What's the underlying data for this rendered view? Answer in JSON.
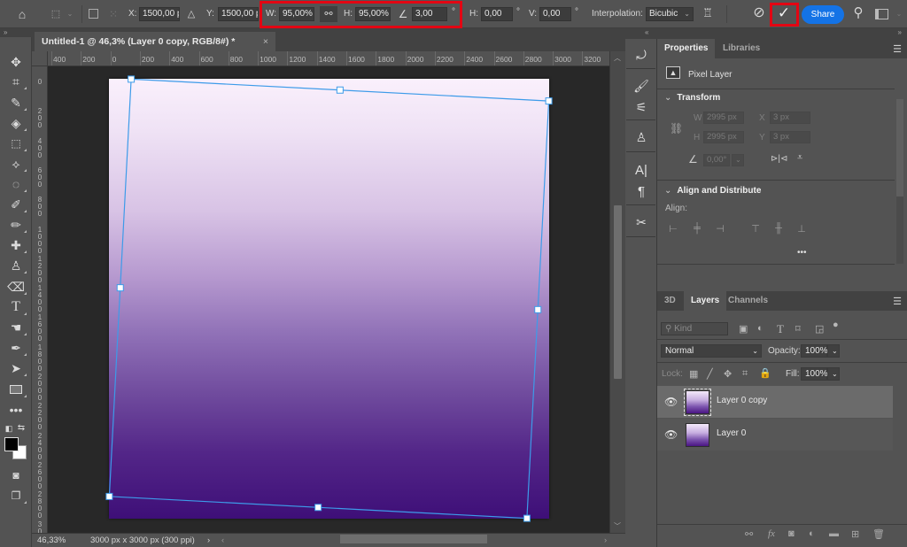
{
  "options_bar": {
    "x_label": "X:",
    "x_value": "1500,00 p",
    "y_label": "Y:",
    "y_value": "1500,00 p",
    "w_label": "W:",
    "w_value": "95,00%",
    "h_label": "H:",
    "h_value": "95,00%",
    "angle_value": "3,00",
    "degree": "°",
    "skew_h_label": "H:",
    "skew_h_value": "0,00",
    "skew_v_label": "V:",
    "skew_v_value": "0,00",
    "interpolation_label": "Interpolation:",
    "interpolation_value": "Bicubic",
    "share_label": "Share",
    "highlight_color": "#e30613"
  },
  "document": {
    "tab_title": "Untitled-1 @ 46,3% (Layer 0 copy, RGB/8#) *",
    "close_glyph": "×",
    "zoom": "46,33%",
    "doc_info": "3000 px x 3000 px (300 ppi)",
    "gradient_top": "#faf0fc",
    "gradient_bottom": "#3e0f78",
    "transform_rotation_deg": 3.0,
    "transform_scale_percent": 95
  },
  "rulers": {
    "horizontal": [
      "400",
      "200",
      "0",
      "200",
      "400",
      "600",
      "800",
      "1000",
      "1200",
      "1400",
      "1600",
      "1800",
      "2000",
      "2200",
      "2400",
      "2600",
      "2800",
      "3000",
      "3200"
    ],
    "vertical": [
      "0",
      "200",
      "400",
      "600",
      "800",
      "1000",
      "1200",
      "1400",
      "1600",
      "1800",
      "2000",
      "2200",
      "2400",
      "2600",
      "2800",
      "30"
    ]
  },
  "properties": {
    "tabs": [
      "Properties",
      "Libraries"
    ],
    "active_tab": "Properties",
    "layer_type": "Pixel Layer",
    "transform_title": "Transform",
    "w_label": "W",
    "w_value": "2995 px",
    "h_label": "H",
    "h_value": "2995 px",
    "x_label": "X",
    "x_value": "3 px",
    "y_label": "Y",
    "y_value": "3 px",
    "angle_value": "0,00°",
    "align_title": "Align and Distribute",
    "align_label": "Align:",
    "more": "•••"
  },
  "layers_panel": {
    "tabs": [
      "3D",
      "Layers",
      "Channels"
    ],
    "active_tab": "Layers",
    "filter_placeholder": "Kind",
    "blend_mode": "Normal",
    "opacity_label": "Opacity:",
    "opacity_value": "100%",
    "lock_label": "Lock:",
    "fill_label": "Fill:",
    "fill_value": "100%",
    "layers": [
      {
        "name": "Layer 0 copy",
        "visible": true,
        "selected": true
      },
      {
        "name": "Layer 0",
        "visible": true,
        "selected": false
      }
    ]
  }
}
